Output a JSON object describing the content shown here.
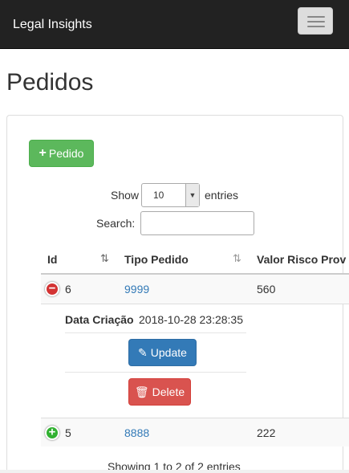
{
  "navbar": {
    "brand": "Legal Insights",
    "toggle_icon": "hamburger-icon"
  },
  "page": {
    "title": "Pedidos"
  },
  "toolbar": {
    "add_label": "Pedido",
    "add_icon": "plus-icon"
  },
  "length": {
    "show_label": "Show",
    "selected": "10",
    "entries_label": "entries"
  },
  "search": {
    "label": "Search:",
    "value": ""
  },
  "table": {
    "columns": [
      "Id",
      "Tipo Pedido",
      "Valor Risco Prov"
    ],
    "rows": [
      {
        "id": "6",
        "tipo": "9999",
        "valor": "560",
        "expanded": true,
        "detail": {
          "label": "Data Criação",
          "value": "2018-10-28 23:28:35"
        }
      },
      {
        "id": "5",
        "tipo": "8888",
        "valor": "222",
        "expanded": false
      }
    ],
    "actions": {
      "update_label": "Update",
      "delete_label": "Delete"
    }
  },
  "info": "Showing 1 to 2 of 2 entries",
  "colors": {
    "navbar": "#222222",
    "success": "#5cb85c",
    "primary": "#337ab7",
    "danger": "#d9534f",
    "link": "#337ab7"
  }
}
